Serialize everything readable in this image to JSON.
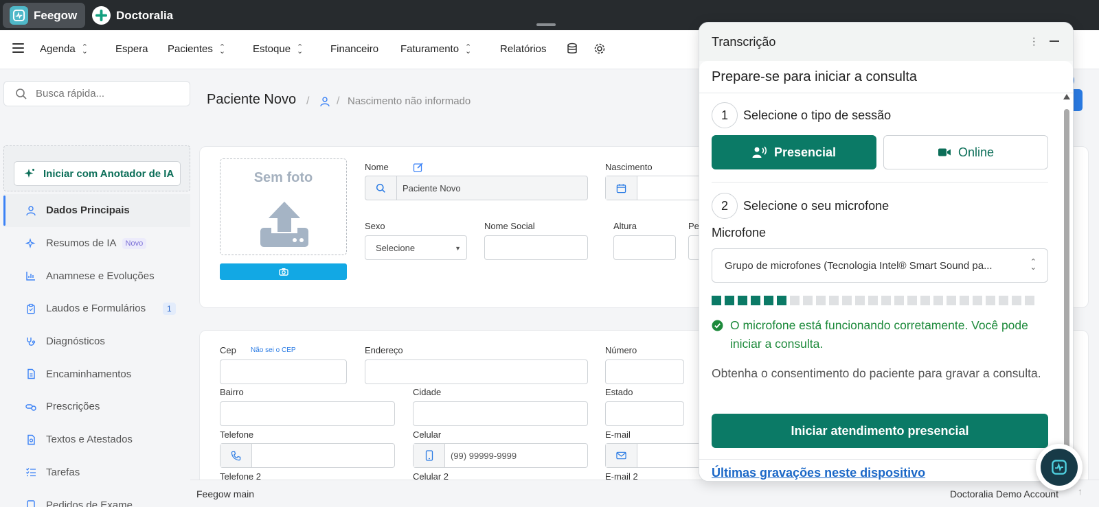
{
  "tabs": [
    {
      "label": "Feegow",
      "active": true
    },
    {
      "label": "Doctoralia",
      "active": false
    }
  ],
  "nav": {
    "items": [
      "Agenda",
      "Espera",
      "Pacientes",
      "Estoque",
      "Financeiro",
      "Faturamento",
      "Relatórios"
    ]
  },
  "sidebar": {
    "search_placeholder": "Busca rápida...",
    "ai_button": "Iniciar com Anotador de IA",
    "items": [
      {
        "label": "Dados Principais"
      },
      {
        "label": "Resumos de IA",
        "badge": "Novo"
      },
      {
        "label": "Anamnese e Evoluções"
      },
      {
        "label": "Laudos e Formulários",
        "count": "1"
      },
      {
        "label": "Diagnósticos"
      },
      {
        "label": "Encaminhamentos"
      },
      {
        "label": "Prescrições"
      },
      {
        "label": "Textos e Atestados"
      },
      {
        "label": "Tarefas"
      },
      {
        "label": "Pedidos de Exame"
      }
    ]
  },
  "patient": {
    "title": "Paciente Novo",
    "dob": "Nascimento não informado",
    "photo_label": "Sem foto"
  },
  "form": {
    "nome_label": "Nome",
    "nome_value": "Paciente Novo",
    "nascimento_label": "Nascimento",
    "sexo_label": "Sexo",
    "sexo_value": "Selecione",
    "nome_social_label": "Nome Social",
    "altura_label": "Altura",
    "peso_label": "Pe",
    "cep_label": "Cep",
    "cep_link": "Não sei o CEP",
    "endereco_label": "Endereço",
    "numero_label": "Número",
    "bairro_label": "Bairro",
    "cidade_label": "Cidade",
    "estado_label": "Estado",
    "telefone_label": "Telefone",
    "celular_label": "Celular",
    "celular_placeholder": "(99) 99999-9999",
    "email_label": "E-mail",
    "telefone2_label": "Telefone 2",
    "celular2_label": "Celular 2",
    "email2_label": "E-mail 2"
  },
  "footer": {
    "left": "Feegow main",
    "right": "Doctoralia Demo Account"
  },
  "panel": {
    "header": "Transcrição",
    "title": "Prepare-se para iniciar a consulta",
    "step1_num": "1",
    "step1_label": "Selecione o tipo de sessão",
    "presencial": "Presencial",
    "online": "Online",
    "step2_num": "2",
    "step2_label": "Selecione o seu microfone",
    "mic_label": "Microfone",
    "mic_value": "Grupo de microfones (Tecnologia Intel® Smart Sound pa...",
    "mic_level": 0.23,
    "ok_message": "O microfone está funcionando corretamente. Você pode iniciar a consulta.",
    "consent": "Obtenha o consentimento do paciente para gravar a consulta.",
    "start_button": "Iniciar atendimento presencial",
    "recent_link": "Últimas gravações neste dispositivo"
  },
  "colors": {
    "brand_green": "#0b7a66",
    "success_green": "#1d8a3b",
    "link_blue": "#1a67c7",
    "accent_blue": "#2a7be4"
  }
}
